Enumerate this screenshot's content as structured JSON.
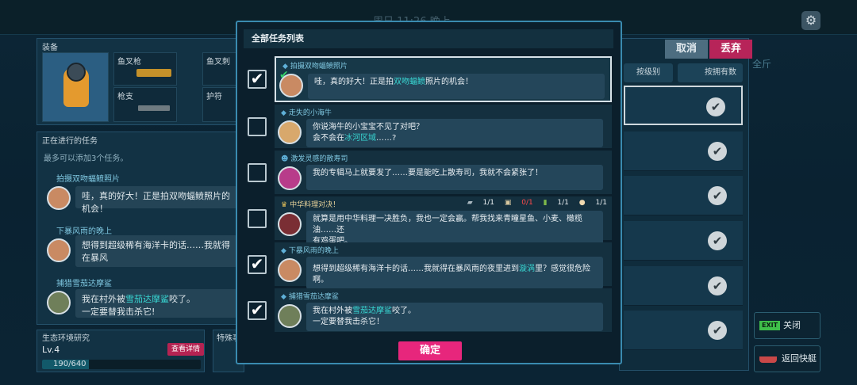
{
  "topbar": {
    "date": "周日 11:26  晚上"
  },
  "equipment": {
    "title": "装备",
    "slots": [
      {
        "label": "鱼叉枪"
      },
      {
        "label": "鱼叉刺"
      },
      {
        "label": "枪支"
      },
      {
        "label": "护符"
      }
    ]
  },
  "ongoing": {
    "title": "正在进行的任务",
    "subtitle": "最多可以添加3个任务。",
    "quests": [
      {
        "title": "拍摄双吻蝠鲼照片",
        "text": "哇，真的好大！正是拍双吻蝠鲼照片的机会！"
      },
      {
        "title": "下暴风雨的晚上",
        "text1": "想得到超级稀有海洋卡的话……我就得在暴风"
      },
      {
        "title": "捕猎雪茄达摩鲨",
        "text1": "我在村外被",
        "hl": "雪茄达摩鲨",
        "text2": "咬了。",
        "text3": "一定要替我击杀它!"
      }
    ]
  },
  "ecosystem": {
    "title": "生态环境研究",
    "level": "Lv.4",
    "detail_btn": "查看详情",
    "progress": "190/640",
    "progress_value": 0.297
  },
  "special": {
    "title": "特殊事"
  },
  "right": {
    "cancel": "取消",
    "discard": "丢弃",
    "sort_grade": "按级别",
    "sort_count": "按拥有数",
    "side_text": "全斤"
  },
  "side_buttons": {
    "exit_tag": "EXIT",
    "close": "关闭",
    "return": "返回快艇"
  },
  "modal": {
    "title": "全部任务列表",
    "items": [
      {
        "checked": true,
        "title": "拍摄双吻蝠鲼照片",
        "line1a": "哇，真的好大！正是拍",
        "line1hl": "双吻蝠鲼",
        "line1b": "照片的机会！",
        "selected": true
      },
      {
        "checked": false,
        "title": "走失的小海牛",
        "line1": "你说海牛的小宝宝不见了对吧？",
        "line2a": "会不会在",
        "line2hl": "冰河区域",
        "line2b": "……?"
      },
      {
        "checked": false,
        "title": "激发灵感的散寿司",
        "line1": "我的专辑马上就要发了……要是能吃上散寿司，我就不会紧张了！"
      },
      {
        "checked": false,
        "title": "中华料理对决！",
        "line1": "就算是用中华料理一决胜负，我也一定会赢。帮我找来青瞳星鱼、小麦、橄榄油……还",
        "line2": "有鸡蛋吧。",
        "counts": [
          {
            "v": "1/1"
          },
          {
            "v": "0/1",
            "red": true
          },
          {
            "v": "1/1"
          },
          {
            "v": "1/1"
          }
        ]
      },
      {
        "checked": true,
        "title": "下暴风雨的晚上",
        "line1a": "想得到超级稀有海洋卡的话……我就得在暴风雨的夜里进到",
        "line1hl": "漩涡",
        "line1b": "里？感觉很危险啊。"
      },
      {
        "checked": true,
        "title": "捕猎雪茄达摩鲨",
        "line1a": "我在村外被",
        "line1hl": "雪茄达摩鲨",
        "line1b": "咬了。",
        "line2": "一定要替我击杀它！"
      }
    ],
    "confirm": "确定"
  }
}
